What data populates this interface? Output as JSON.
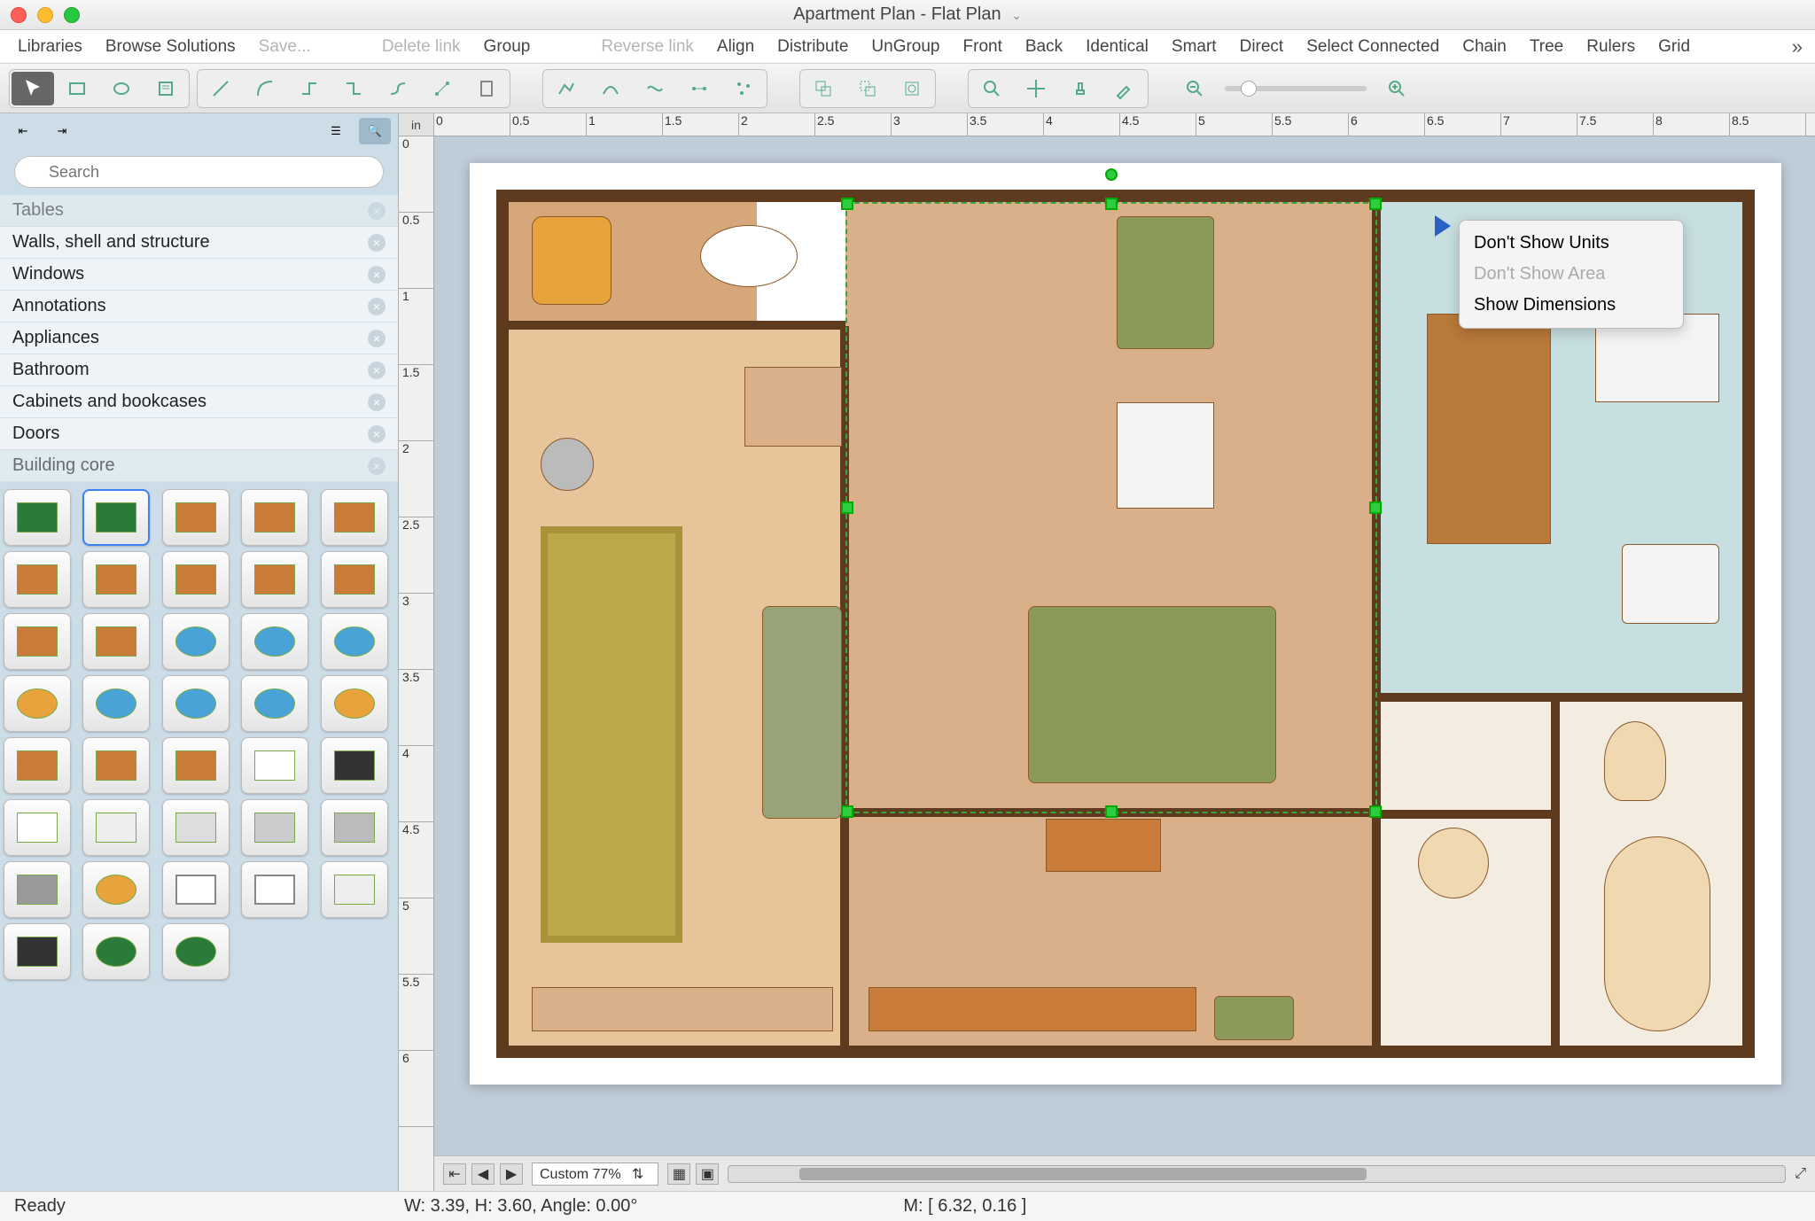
{
  "title": "Apartment Plan - Flat Plan",
  "menu": {
    "libraries": "Libraries",
    "browse": "Browse Solutions",
    "save": "Save...",
    "delete_link": "Delete link",
    "group": "Group",
    "reverse_link": "Reverse link",
    "align": "Align",
    "distribute": "Distribute",
    "ungroup": "UnGroup",
    "front": "Front",
    "back": "Back",
    "identical": "Identical",
    "smart": "Smart",
    "direct": "Direct",
    "select_connected": "Select Connected",
    "chain": "Chain",
    "tree": "Tree",
    "rulers": "Rulers",
    "grid": "Grid"
  },
  "search": {
    "placeholder": "Search"
  },
  "categories": [
    "Tables",
    "Walls, shell and structure",
    "Windows",
    "Annotations",
    "Appliances",
    "Bathroom",
    "Cabinets and bookcases",
    "Doors",
    "Building core"
  ],
  "ruler_unit": "in",
  "ruler_h": [
    "0",
    "0.5",
    "1",
    "1.5",
    "2",
    "2.5",
    "3",
    "3.5",
    "4",
    "4.5",
    "5",
    "5.5",
    "6",
    "6.5",
    "7",
    "7.5",
    "8",
    "8.5"
  ],
  "ruler_v": [
    "0",
    "0.5",
    "1",
    "1.5",
    "2",
    "2.5",
    "3",
    "3.5",
    "4",
    "4.5",
    "5",
    "5.5",
    "6"
  ],
  "context_menu": {
    "item1": "Don't Show Units",
    "item2": "Don't Show Area",
    "item3": "Show Dimensions"
  },
  "zoom": {
    "label": "Custom 77%"
  },
  "status": {
    "ready": "Ready",
    "dims": "W: 3.39,  H: 3.60,  Angle: 0.00°",
    "mouse": "M: [ 6.32, 0.16 ]"
  }
}
